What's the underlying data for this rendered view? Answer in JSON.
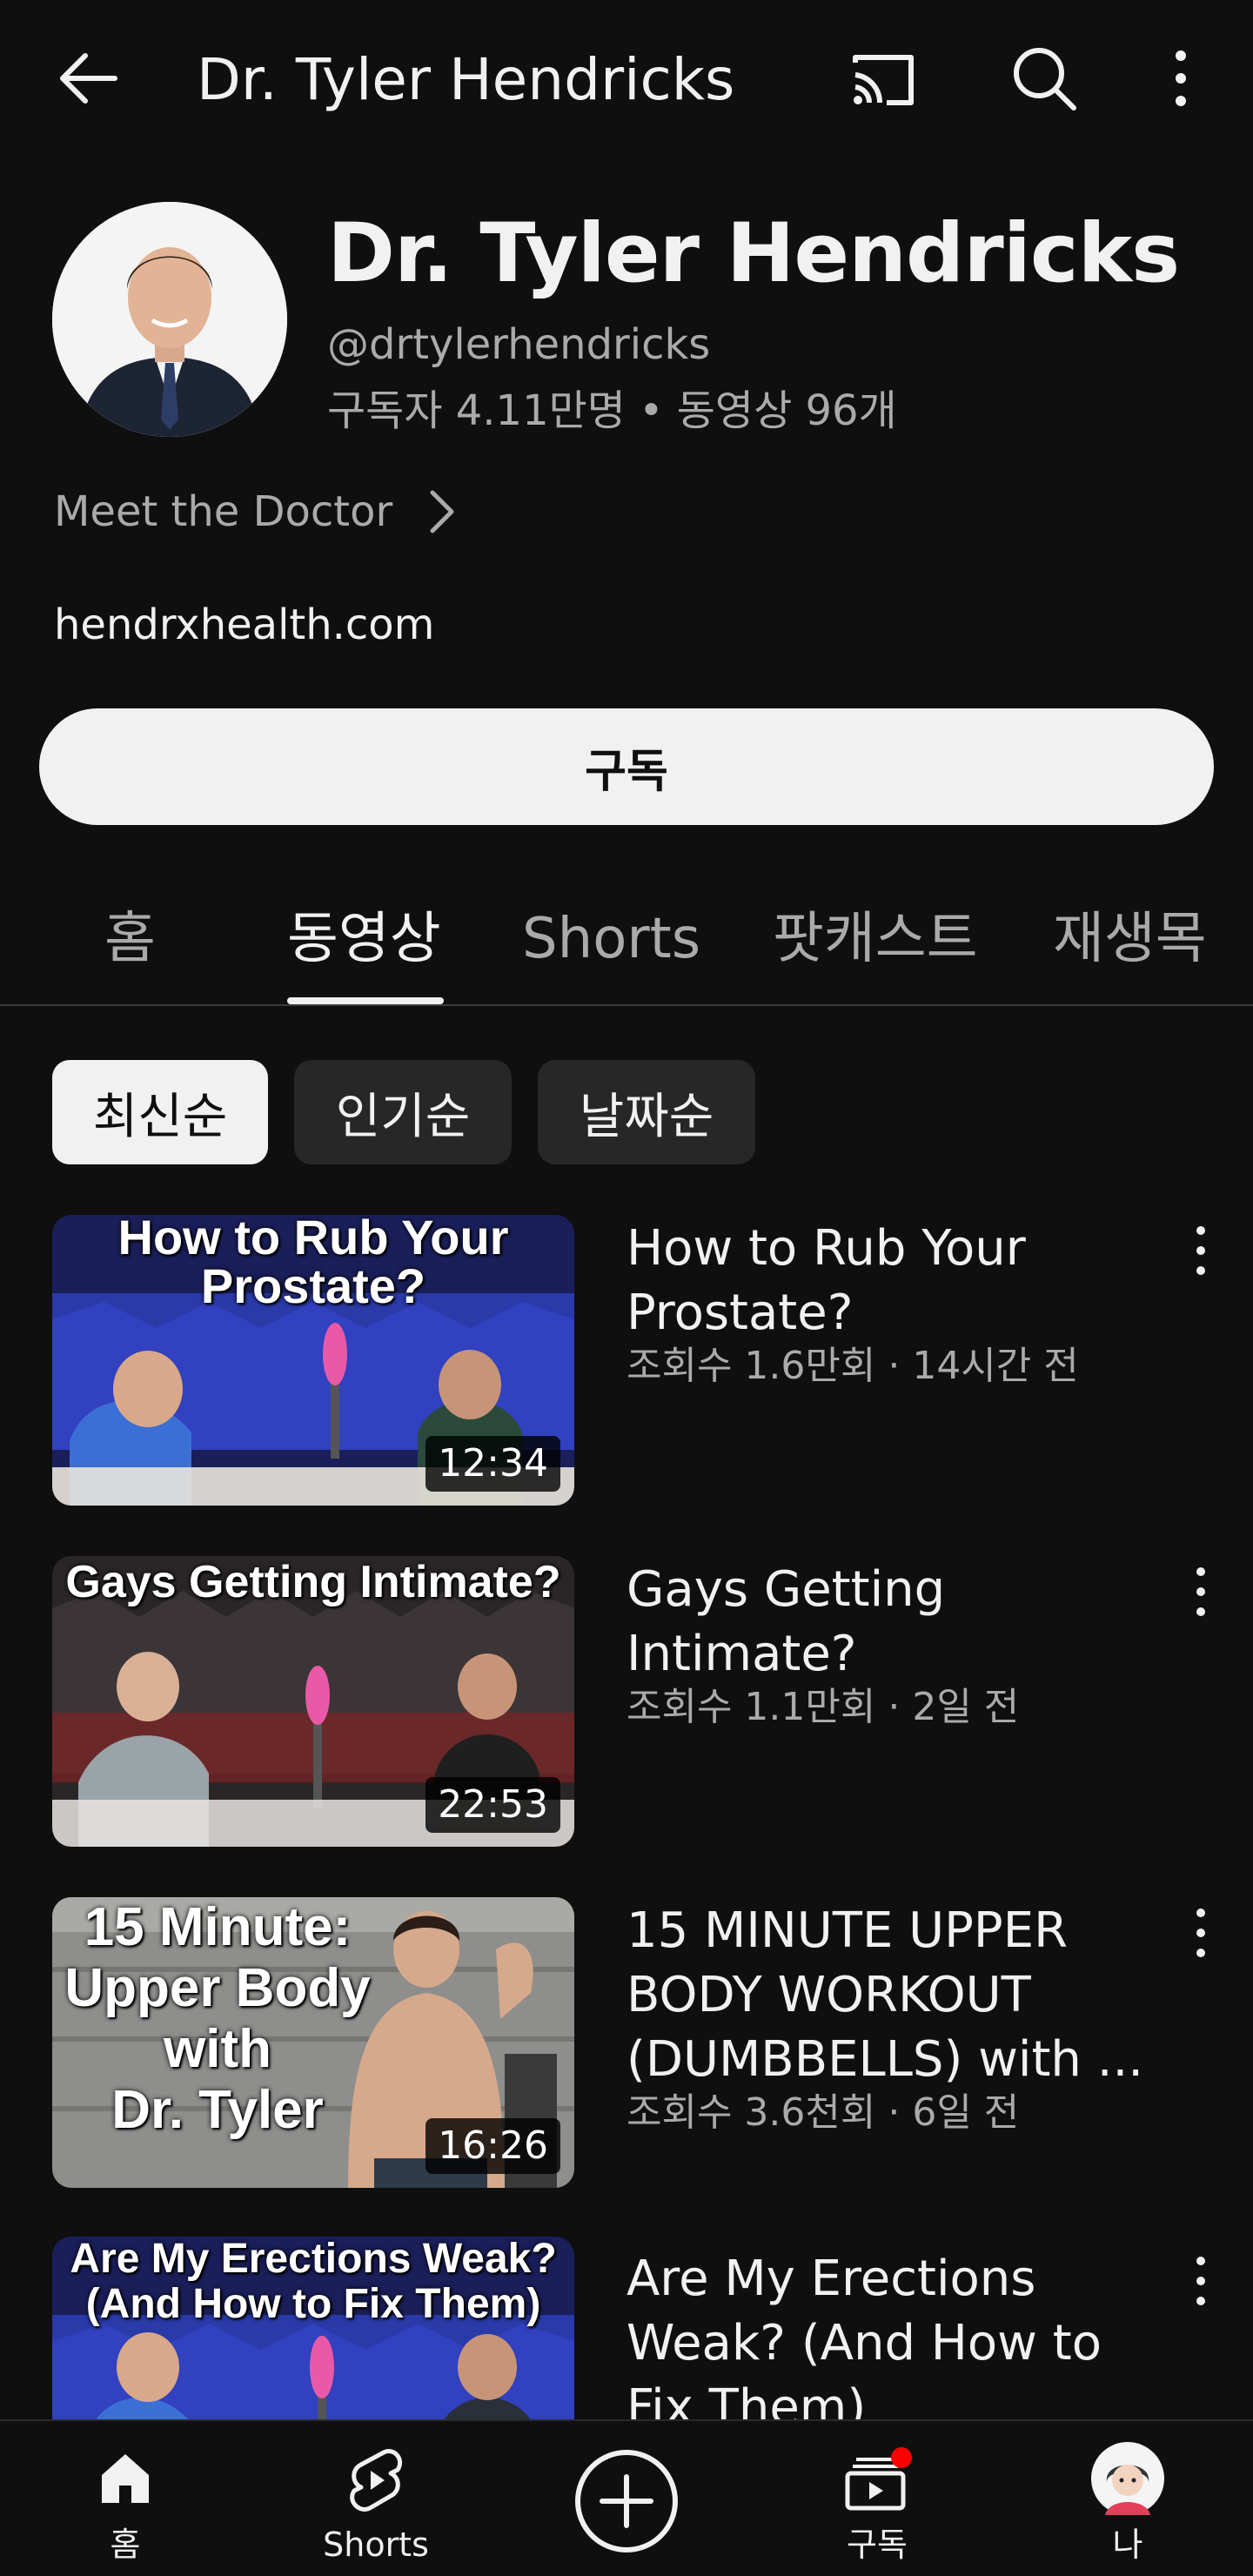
{
  "topbar": {
    "title": "Dr. Tyler Hendricks"
  },
  "channel": {
    "name": "Dr. Tyler Hendricks",
    "handle": "@drtylerhendricks",
    "stats": "구독자 4.11만명 • 동영상 96개",
    "about_label": "Meet the Doctor",
    "website": "hendrxhealth.com",
    "subscribe_label": "구독"
  },
  "tabs": [
    {
      "label": "홈",
      "active": false
    },
    {
      "label": "동영상",
      "active": true
    },
    {
      "label": "Shorts",
      "active": false
    },
    {
      "label": "팟캐스트",
      "active": false
    },
    {
      "label": "재생목",
      "active": false
    }
  ],
  "chips": [
    {
      "label": "최신순",
      "selected": true
    },
    {
      "label": "인기순",
      "selected": false
    },
    {
      "label": "날짜순",
      "selected": false
    }
  ],
  "videos": [
    {
      "thumb_text": "How to Rub Your\nProstate?",
      "duration": "12:34",
      "title": "How to Rub Your Prostate?",
      "meta": "조회수 1.6만회 · 14시간 전"
    },
    {
      "thumb_text": "Gays Getting Intimate?",
      "duration": "22:53",
      "title": "Gays Getting Intimate?",
      "meta": "조회수 1.1만회 · 2일 전"
    },
    {
      "thumb_text": "15 Minute:\nUpper Body\nwith\nDr. Tyler",
      "duration": "16:26",
      "title": "15 MINUTE UPPER BODY WORKOUT (DUMBBELLS) with ...",
      "meta": "조회수 3.6천회 · 6일 전"
    },
    {
      "thumb_text": "Are My Erections Weak?\n(And How to Fix Them)",
      "duration": "",
      "title": "Are My Erections Weak? (And How to Fix Them)",
      "meta": ""
    }
  ],
  "bottom_nav": [
    {
      "label": "홈",
      "icon": "home-icon"
    },
    {
      "label": "Shorts",
      "icon": "shorts-icon"
    },
    {
      "label": "",
      "icon": "create-icon"
    },
    {
      "label": "구독",
      "icon": "subscriptions-icon"
    },
    {
      "label": "나",
      "icon": "avatar-icon"
    }
  ],
  "colors": {
    "background": "#0f0f0f",
    "text_primary": "#f1f1f1",
    "text_secondary": "#aaaaaa",
    "chip_unselected": "#272727",
    "notification_dot": "#ff0000"
  }
}
